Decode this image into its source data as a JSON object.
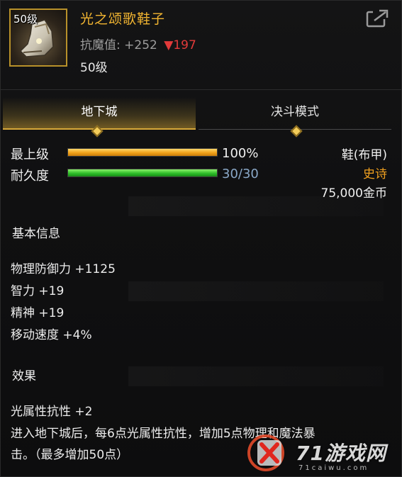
{
  "item": {
    "level_badge": "50级",
    "name": "光之颂歌鞋子",
    "resist_label": "抗魔值:",
    "resist_value": "+252",
    "resist_down_symbol": "▼",
    "resist_down_value": "197",
    "required_level": "50级",
    "name_color": "#f2b531"
  },
  "icons": {
    "share": "share-export-icon",
    "item": "boots-icon"
  },
  "tabs": [
    {
      "label": "地下城",
      "active": true
    },
    {
      "label": "决斗模式",
      "active": false
    }
  ],
  "bars": {
    "max_level": {
      "label": "最上级",
      "value": "100%",
      "fill": 1.0
    },
    "durability": {
      "label": "耐久度",
      "value": "30/30",
      "fill": 1.0
    }
  },
  "right_info": {
    "type": "鞋(布甲)",
    "rarity": "史诗",
    "price": "75,000金币",
    "rarity_color": "#f0a01f"
  },
  "basic_info": {
    "title": "基本信息",
    "attrs": [
      "物理防御力 +1125",
      "智力 +19",
      "精神 +19",
      "移动速度 +4%"
    ]
  },
  "effects": {
    "title": "效果",
    "lines": [
      "光属性抗性 +2",
      "进入地下城后，每6点光属性抗性，增加5点物理和魔法暴",
      "击。（最多增加50点）"
    ]
  },
  "watermark": {
    "text": "71游戏网",
    "url": "71caiwu.com"
  }
}
